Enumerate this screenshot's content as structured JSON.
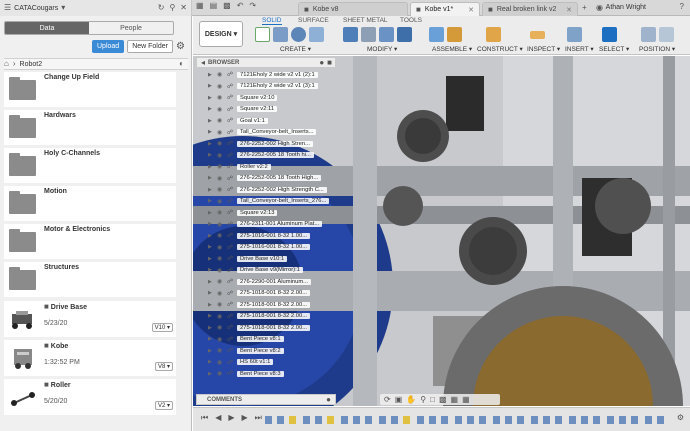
{
  "left_panel": {
    "team": "CATACougars",
    "tabs": [
      "Data",
      "People"
    ],
    "active_tab": "Data",
    "upload_label": "Upload",
    "new_folder_label": "New Folder",
    "breadcrumb": "Robot2",
    "folders": [
      "Change Up Field",
      "Hardwars",
      "Holy C-Channels",
      "Motion",
      "Motor & Electronics",
      "Structures"
    ],
    "designs": [
      {
        "name": "Drive Base",
        "date": "5/23/20",
        "version": "V10"
      },
      {
        "name": "Kobe",
        "date": "1:32:52 PM",
        "version": "V8"
      },
      {
        "name": "Roller",
        "date": "5/20/20",
        "version": "V2"
      }
    ]
  },
  "tabs": [
    {
      "label": "Kobe v8",
      "active": false
    },
    {
      "label": "Kobe v1*",
      "active": true
    },
    {
      "label": "Real broken link v2",
      "active": false
    }
  ],
  "user": "Athan Wright",
  "toolbar": {
    "workspace": "DESIGN",
    "tabs": [
      "SOLID",
      "SURFACE",
      "SHEET METAL",
      "TOOLS"
    ],
    "active_tab": "SOLID",
    "groups": [
      "CREATE",
      "MODIFY",
      "ASSEMBLE",
      "CONSTRUCT",
      "INSPECT",
      "INSERT",
      "SELECT",
      "POSITION"
    ]
  },
  "browser": {
    "title": "BROWSER",
    "comments_label": "COMMENTS",
    "rows": [
      "7121Eholy 2 wide v2 v1 (2):1",
      "7121Eholy 2 wide v2 v1 (3):1",
      "Square v2:10",
      "Square v2:11",
      "Goal v1:1",
      "Tall_Conveyor-belt_Inserts...",
      "276-2252-002 High Stren...",
      "276-2252-005 18 Tooth hi...",
      "Roller v2:2",
      "276-2252-005 18 Tooth High...",
      "276-2252-002 High Strength C...",
      "Tall_Conveyor-belt_Inserts_276...",
      "Square v2:13",
      "276-2311-001 Aluminum Plat...",
      "275-1016-001 8-32 1.00...",
      "275-1016-001 8-32 1.00...",
      "Drive Base v10:1",
      "Drive Base v9(Mirror):1",
      "276-2290-001 Aluminum...",
      "275-1018-001 8-32 2.00...",
      "275-1018-001 8-32 2.00...",
      "275-1018-001 8-32 2.00...",
      "275-1018-001 8-32 2.00...",
      "Bent Piece v8:1",
      "Bent Piece v8:2",
      "HS 60t v1:1",
      "Bent Piece v8:3"
    ]
  },
  "colors": {
    "accent": "#1d6fc2",
    "upload": "#3a8ad6"
  }
}
